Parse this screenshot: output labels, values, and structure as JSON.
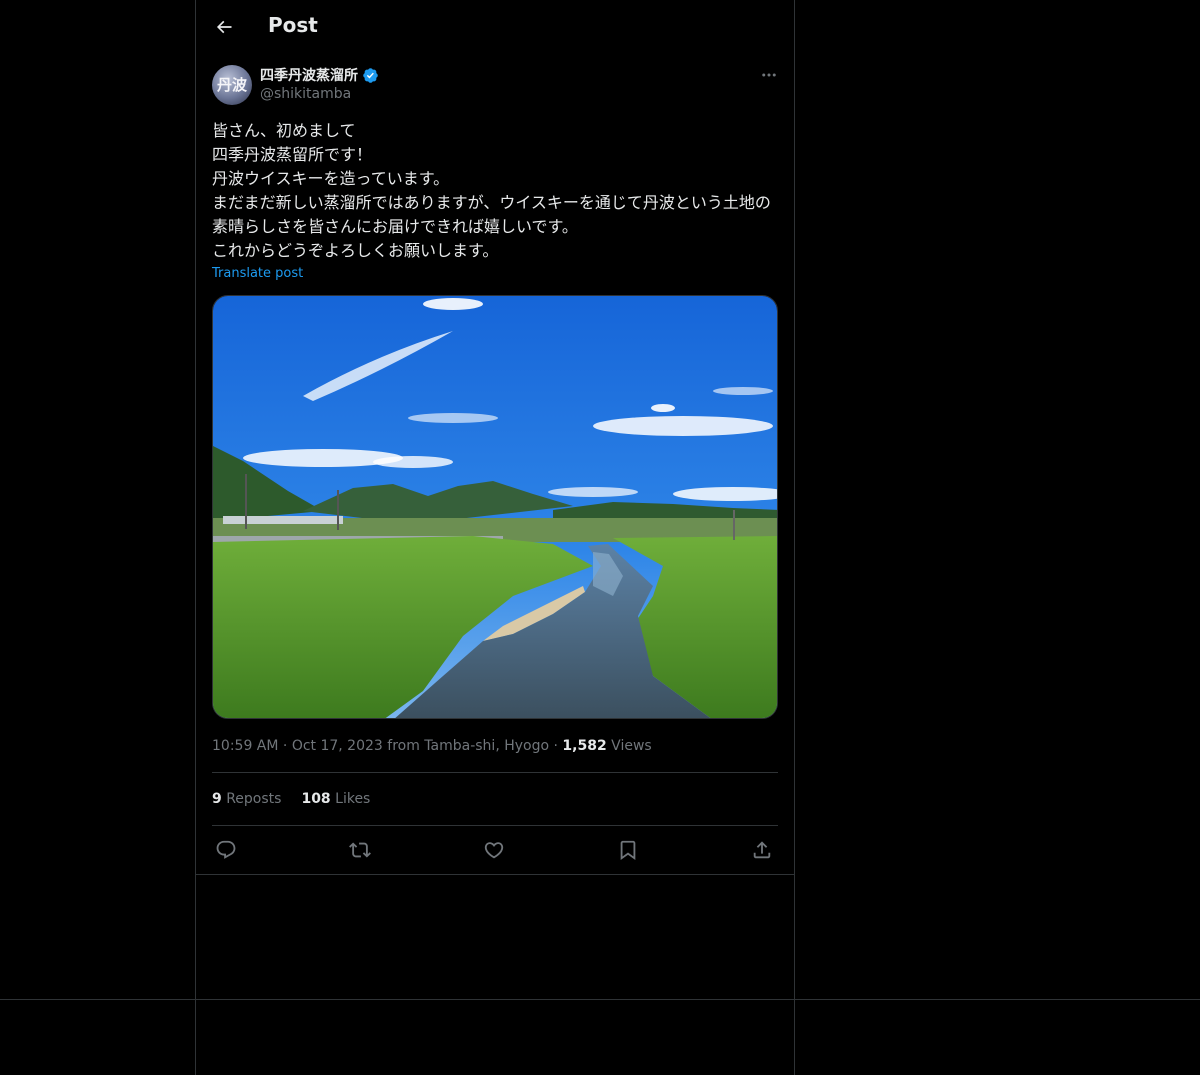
{
  "header": {
    "title": "Post",
    "back_icon": "arrow-left-icon"
  },
  "author": {
    "display_name": "四季丹波蒸溜所",
    "handle": "@shikitamba",
    "verified": true,
    "avatar_text": "丹波"
  },
  "post": {
    "text": "皆さん、初めまして\n四季丹波蒸留所です！\n丹波ウイスキーを造っています。\nまだまだ新しい蒸溜所ではありますが、ウイスキーを通じて丹波という土地の素晴らしさを皆さんにお届けできれば嬉しいです。\nこれからどうぞよろしくお願いします。",
    "translate_label": "Translate post",
    "time": "10:59 AM",
    "date": "Oct 17, 2023",
    "location": "from Tamba-shi, Hyogo",
    "views_count": "1,582",
    "views_label": "Views"
  },
  "stats": {
    "reposts_count": "9",
    "reposts_label": "Reposts",
    "likes_count": "108",
    "likes_label": "Likes"
  },
  "actions": [
    "reply-icon",
    "repost-icon",
    "like-icon",
    "bookmark-icon",
    "share-icon"
  ],
  "colors": {
    "background": "#000000",
    "text": "#e7e9ea",
    "muted": "#71767b",
    "accent": "#1d9bf0",
    "border": "#2f3336"
  }
}
